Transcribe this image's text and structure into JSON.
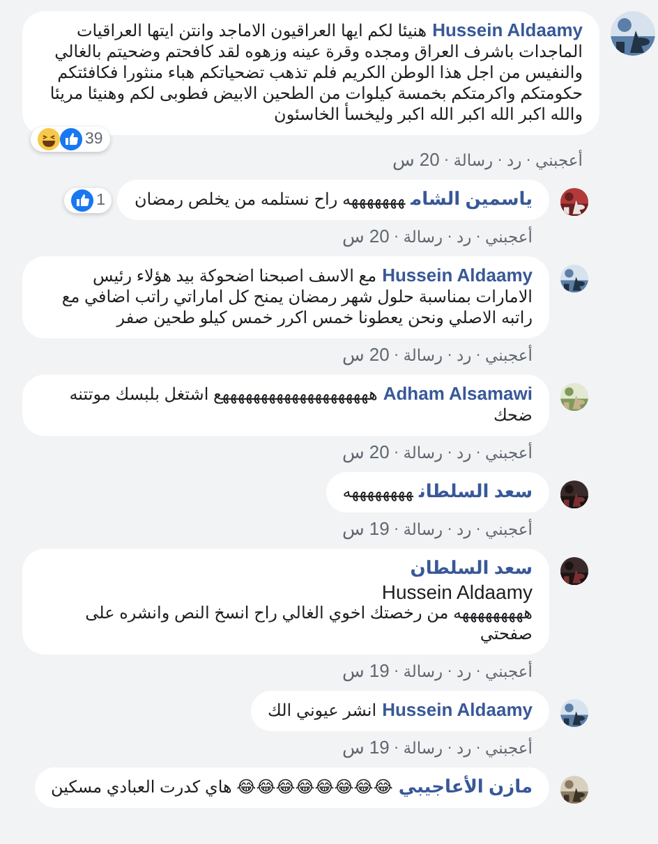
{
  "separator": "·",
  "comments": [
    {
      "kind": "top",
      "name": "Hussein Aldaamy",
      "text": "هنيئا لكم ايها العراقيون الاماجد وانتن ايتها العراقيات الماجدات باشرف العراق ومجده وقرة عينه وزهوه لقد كافحتم وضحيتم بالغالي والنفيس من اجل هذا الوطن الكريم فلم تذهب تضحياتكم هباء منثورا فكافئتكم حكومتكم واكرمتكم بخمسة كيلوات من الطحين الابيض فطوبى لكم وهنيئا مريئا والله اكبر الله اكبر الله اكبر وليخسأ الخاسئون",
      "reactions": {
        "icons": [
          {
            "kind": "like"
          },
          {
            "kind": "haha"
          }
        ],
        "count": "39"
      },
      "actions": [
        "أعجبني",
        "رد",
        "رسالة"
      ],
      "time": "20 س"
    },
    {
      "kind": "reply",
      "name": "ياسمين الشام",
      "text": "هههههههه راح نستلمه من يخلص رمضان",
      "reactions": {
        "icons": [
          {
            "kind": "like"
          }
        ],
        "count": "1"
      },
      "actions": [
        "أعجبني",
        "رد",
        "رسالة"
      ],
      "time": "20 س"
    },
    {
      "kind": "reply",
      "name": "Hussein Aldaamy",
      "text": "مع الاسف اصبحنا اضحوكة بيد هؤلاء رئيس الامارات بمناسبة حلول شهر رمضان يمنح كل اماراتي راتب اضافي مع راتبه الاصلي ونحن يعطونا خمس اكرر خمس كيلو طحين صفر",
      "actions": [
        "أعجبني",
        "رد",
        "رسالة"
      ],
      "time": "20 س"
    },
    {
      "kind": "reply",
      "name": "Adham Alsamawi",
      "text": "ههههههههههههههههههههع اشتغل بلبسك موتتنه ضحك",
      "actions": [
        "أعجبني",
        "رد",
        "رسالة"
      ],
      "time": "20 س"
    },
    {
      "kind": "reply",
      "name": "سعد السلطان",
      "text": "ههههههههه",
      "actions": [
        "أعجبني",
        "رد",
        "رسالة"
      ],
      "time": "19 س"
    },
    {
      "kind": "reply",
      "name": "سعد السلطان",
      "mention": "Hussein Aldaamy",
      "text": "هههههههههه من رخصتك اخوي الغالي راح انسخ النص وانشره على صفحتي",
      "actions": [
        "أعجبني",
        "رد",
        "رسالة"
      ],
      "time": "19 س"
    },
    {
      "kind": "reply",
      "name": "Hussein Aldaamy",
      "text": "انشر عيوني الك",
      "actions": [
        "أعجبني",
        "رد",
        "رسالة"
      ],
      "time": "19 س"
    },
    {
      "kind": "reply",
      "name": "مازن الأعاجيبي",
      "text": "😂😂😂😂😂😂😂😂 هاي كدرت العبادي مسكين"
    }
  ]
}
